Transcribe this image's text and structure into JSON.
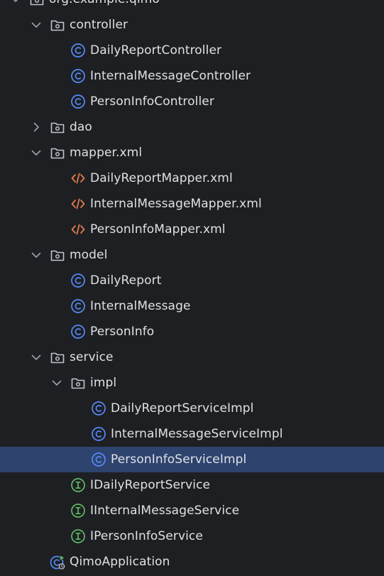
{
  "project_tree": {
    "items": [
      {
        "label": "org.example.qimo",
        "type": "package",
        "expanded": true,
        "depth": 0,
        "name": "package-org-example-qimo"
      },
      {
        "label": "controller",
        "type": "package",
        "expanded": true,
        "depth": 1,
        "name": "package-controller"
      },
      {
        "label": "DailyReportController",
        "type": "class",
        "depth": 2,
        "name": "class-daily-report-controller"
      },
      {
        "label": "InternalMessageController",
        "type": "class",
        "depth": 2,
        "name": "class-internal-message-controller"
      },
      {
        "label": "PersonInfoController",
        "type": "class",
        "depth": 2,
        "name": "class-person-info-controller"
      },
      {
        "label": "dao",
        "type": "package",
        "expanded": false,
        "depth": 1,
        "name": "package-dao"
      },
      {
        "label": "mapper.xml",
        "type": "package",
        "expanded": true,
        "depth": 1,
        "name": "package-mapper-xml"
      },
      {
        "label": "DailyReportMapper.xml",
        "type": "xml",
        "depth": 2,
        "name": "file-daily-report-mapper-xml"
      },
      {
        "label": "InternalMessageMapper.xml",
        "type": "xml",
        "depth": 2,
        "name": "file-internal-message-mapper-xml"
      },
      {
        "label": "PersonInfoMapper.xml",
        "type": "xml",
        "depth": 2,
        "name": "file-person-info-mapper-xml"
      },
      {
        "label": "model",
        "type": "package",
        "expanded": true,
        "depth": 1,
        "name": "package-model"
      },
      {
        "label": "DailyReport",
        "type": "class",
        "depth": 2,
        "name": "class-daily-report"
      },
      {
        "label": "InternalMessage",
        "type": "class",
        "depth": 2,
        "name": "class-internal-message"
      },
      {
        "label": "PersonInfo",
        "type": "class",
        "depth": 2,
        "name": "class-person-info"
      },
      {
        "label": "service",
        "type": "package",
        "expanded": true,
        "depth": 1,
        "name": "package-service"
      },
      {
        "label": "impl",
        "type": "package",
        "expanded": true,
        "depth": 2,
        "name": "package-impl"
      },
      {
        "label": "DailyReportServiceImpl",
        "type": "class",
        "depth": 3,
        "name": "class-daily-report-service-impl"
      },
      {
        "label": "InternalMessageServiceImpl",
        "type": "class",
        "depth": 3,
        "name": "class-internal-message-service-impl"
      },
      {
        "label": "PersonInfoServiceImpl",
        "type": "class",
        "depth": 3,
        "selected": true,
        "name": "class-person-info-service-impl"
      },
      {
        "label": "IDailyReportService",
        "type": "interface",
        "depth": 2,
        "name": "interface-idaily-report-service"
      },
      {
        "label": "IInternalMessageService",
        "type": "interface",
        "depth": 2,
        "name": "interface-iinternal-message-service"
      },
      {
        "label": "IPersonInfoService",
        "type": "interface",
        "depth": 2,
        "name": "interface-iperson-info-service"
      },
      {
        "label": "QimoApplication",
        "type": "app-class",
        "depth": 1,
        "name": "class-qimo-application"
      }
    ]
  },
  "colors": {
    "background": "#1e1f22",
    "text": "#dfe1e5",
    "selected_row": "#2e436e",
    "arrow": "#9da0a8",
    "folder_icon": "#c0c3c9",
    "class_icon": "#548af7",
    "interface_icon": "#5fb865",
    "xml_icon": "#e8804f",
    "run_badge": "#5fb865"
  }
}
